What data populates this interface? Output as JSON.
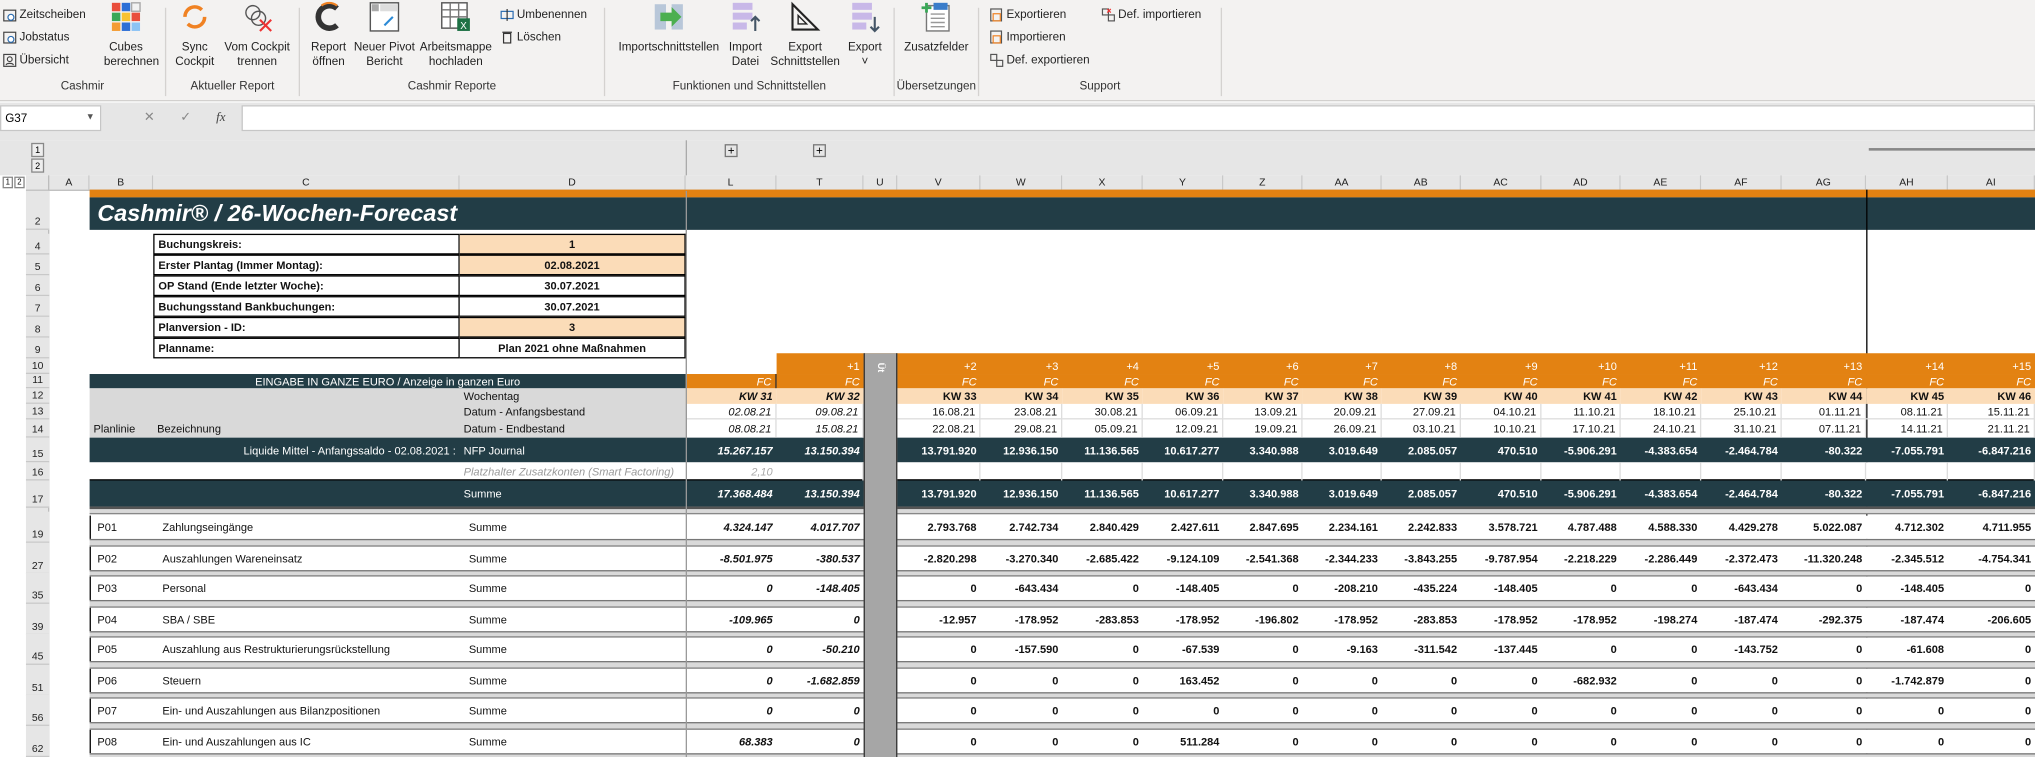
{
  "ribbon": {
    "groups": [
      {
        "label": "Cashmir",
        "items": [
          {
            "label": "Zeitscheiben",
            "icon": "calendar-clock-icon"
          },
          {
            "label": "Jobstatus",
            "icon": "calendar-clock-icon"
          },
          {
            "label": "Übersicht",
            "icon": "user-icon"
          },
          {
            "label": "Cubes\nberechnen",
            "icon": "color-cubes-icon"
          }
        ]
      },
      {
        "label": "Aktueller Report",
        "items": [
          {
            "label": "Sync\nCockpit",
            "icon": "sync-icon"
          },
          {
            "label": "Vom Cockpit\ntrennen",
            "icon": "disconnect-icon"
          }
        ]
      },
      {
        "label": "Cashmir Reporte",
        "items": [
          {
            "label": "Report\nöffnen",
            "icon": "cashmir-logo-icon"
          },
          {
            "label": "Neuer Pivot\nBericht",
            "icon": "pivot-icon"
          },
          {
            "label": "Arbeitsmappe\nhochladen",
            "icon": "excel-upload-icon"
          },
          {
            "label": "Umbenennen",
            "icon": "rename-icon"
          },
          {
            "label": "Löschen",
            "icon": "trash-icon"
          }
        ]
      },
      {
        "label": "Funktionen und Schnittstellen",
        "items": [
          {
            "label": "Importschnittstellen",
            "icon": "import-interface-icon"
          },
          {
            "label": "Import\nDatei",
            "icon": "import-file-icon"
          },
          {
            "label": "Export\nSchnittstellen",
            "icon": "export-interface-icon"
          },
          {
            "label": "Export\n˅",
            "icon": "export-icon"
          }
        ]
      },
      {
        "label": "Übersetzungen",
        "items": [
          {
            "label": "Zusatzfelder",
            "icon": "additional-fields-icon"
          }
        ]
      },
      {
        "label": "Support",
        "items": [
          {
            "label": "Exportieren",
            "icon": "export-table-icon"
          },
          {
            "label": "Importieren",
            "icon": "import-table-icon"
          },
          {
            "label": "Def. exportieren",
            "icon": "def-export-icon"
          },
          {
            "label": "Def. importieren",
            "icon": "def-import-icon"
          }
        ]
      }
    ]
  },
  "formula_bar": {
    "name_box": "G37",
    "cancel": "✕",
    "enter": "✓",
    "fx": "fx",
    "formula": ""
  },
  "outline": {
    "levels": [
      "1",
      "2"
    ],
    "expand": "+"
  },
  "columns": [
    "A",
    "B",
    "C",
    "D",
    "L",
    "T",
    "U",
    "V",
    "W",
    "X",
    "Y",
    "Z",
    "AA",
    "AB",
    "AC",
    "AD",
    "AE",
    "AF",
    "AG",
    "AH",
    "AI"
  ],
  "rows": [
    "2",
    "4",
    "5",
    "6",
    "7",
    "8",
    "9",
    "10",
    "11",
    "12",
    "13",
    "14",
    "15",
    "16",
    "17",
    "19",
    "27",
    "35",
    "39",
    "45",
    "51",
    "56",
    "62"
  ],
  "colors": {
    "dark": "#223d46",
    "orange": "#e38212",
    "peach": "#fbdcb8",
    "separator": "#d9d9d9"
  },
  "sheet": {
    "title": "Cashmir® / 26-Wochen-Forecast",
    "info": [
      {
        "label": "Buchungskreis:",
        "value": "1",
        "highlight": true
      },
      {
        "label": "Erster Plantag (Immer Montag):",
        "value": "02.08.2021",
        "highlight": true
      },
      {
        "label": "OP Stand (Ende letzter Woche):",
        "value": "30.07.2021",
        "highlight": false
      },
      {
        "label": "Buchungsstand Bankbuchungen:",
        "value": "30.07.2021",
        "highlight": false
      },
      {
        "label": "Planversion - ID:",
        "value": "3",
        "highlight": true
      },
      {
        "label": "Planname:",
        "value": "Plan 2021 ohne Maßnahmen",
        "highlight": false
      }
    ],
    "header_band": "EINGABE IN GANZE EURO / Anzeige in ganzen Euro",
    "wochentag_label": "Wochentag",
    "datum_anfang_label": "Datum - Anfangsbestand",
    "datum_end_label": "Datum - Endbestand",
    "planlinie_label": "Planlinie",
    "bezeichnung_label": "Bezeichnung",
    "hidden_col_marker": "Üt",
    "weeks": [
      {
        "col": "L",
        "offset": "",
        "type": "FC",
        "kw": "KW 31",
        "start": "02.08.21",
        "end": "08.08.21"
      },
      {
        "col": "T",
        "offset": "+1",
        "type": "FC",
        "kw": "KW 32",
        "start": "09.08.21",
        "end": "15.08.21"
      },
      {
        "col": "V",
        "offset": "+2",
        "type": "FC",
        "kw": "KW 33",
        "start": "16.08.21",
        "end": "22.08.21"
      },
      {
        "col": "W",
        "offset": "+3",
        "type": "FC",
        "kw": "KW 34",
        "start": "23.08.21",
        "end": "29.08.21"
      },
      {
        "col": "X",
        "offset": "+4",
        "type": "FC",
        "kw": "KW 35",
        "start": "30.08.21",
        "end": "05.09.21"
      },
      {
        "col": "Y",
        "offset": "+5",
        "type": "FC",
        "kw": "KW 36",
        "start": "06.09.21",
        "end": "12.09.21"
      },
      {
        "col": "Z",
        "offset": "+6",
        "type": "FC",
        "kw": "KW 37",
        "start": "13.09.21",
        "end": "19.09.21"
      },
      {
        "col": "AA",
        "offset": "+7",
        "type": "FC",
        "kw": "KW 38",
        "start": "20.09.21",
        "end": "26.09.21"
      },
      {
        "col": "AB",
        "offset": "+8",
        "type": "FC",
        "kw": "KW 39",
        "start": "27.09.21",
        "end": "03.10.21"
      },
      {
        "col": "AC",
        "offset": "+9",
        "type": "FC",
        "kw": "KW 40",
        "start": "04.10.21",
        "end": "10.10.21"
      },
      {
        "col": "AD",
        "offset": "+10",
        "type": "FC",
        "kw": "KW 41",
        "start": "11.10.21",
        "end": "17.10.21"
      },
      {
        "col": "AE",
        "offset": "+11",
        "type": "FC",
        "kw": "KW 42",
        "start": "18.10.21",
        "end": "24.10.21"
      },
      {
        "col": "AF",
        "offset": "+12",
        "type": "FC",
        "kw": "KW 43",
        "start": "25.10.21",
        "end": "31.10.21"
      },
      {
        "col": "AG",
        "offset": "+13",
        "type": "FC",
        "kw": "KW 44",
        "start": "01.11.21",
        "end": "07.11.21"
      },
      {
        "col": "AH",
        "offset": "+14",
        "type": "FC",
        "kw": "KW 45",
        "start": "08.11.21",
        "end": "14.11.21"
      },
      {
        "col": "AI",
        "offset": "+15",
        "type": "FC",
        "kw": "KW 46",
        "start": "15.11.21",
        "end": "21.11.21"
      }
    ],
    "opening": {
      "label": "Liquide Mittel - Anfangssaldo - 02.08.2021 :",
      "source": "NFP Journal",
      "values": [
        "15.267.157",
        "13.150.394",
        "13.791.920",
        "12.936.150",
        "11.136.565",
        "10.617.277",
        "3.340.988",
        "3.019.649",
        "2.085.057",
        "470.510",
        "-5.906.291",
        "-4.383.654",
        "-2.464.784",
        "-80.322",
        "-7.055.791",
        "-6.847.216"
      ]
    },
    "placeholder": {
      "label": "Platzhalter Zusatzkonten (Smart Factoring)",
      "value": "2,10"
    },
    "summe": {
      "label": "Summe",
      "values": [
        "17.368.484",
        "13.150.394",
        "13.791.920",
        "12.936.150",
        "11.136.565",
        "10.617.277",
        "3.340.988",
        "3.019.649",
        "2.085.057",
        "470.510",
        "-5.906.291",
        "-4.383.654",
        "-2.464.784",
        "-80.322",
        "-7.055.791",
        "-6.847.216"
      ]
    },
    "lines": [
      {
        "code": "P01",
        "name": "Zahlungseingänge",
        "agg": "Summe",
        "values": [
          "4.324.147",
          "4.017.707",
          "2.793.768",
          "2.742.734",
          "2.840.429",
          "2.427.611",
          "2.847.695",
          "2.234.161",
          "2.242.833",
          "3.578.721",
          "4.787.488",
          "4.588.330",
          "4.429.278",
          "5.022.087",
          "4.712.302",
          "4.711.955"
        ]
      },
      {
        "code": "P02",
        "name": "Auszahlungen Wareneinsatz",
        "agg": "Summe",
        "values": [
          "-8.501.975",
          "-380.537",
          "-2.820.298",
          "-3.270.340",
          "-2.685.422",
          "-9.124.109",
          "-2.541.368",
          "-2.344.233",
          "-3.843.255",
          "-9.787.954",
          "-2.218.229",
          "-2.286.449",
          "-2.372.473",
          "-11.320.248",
          "-2.345.512",
          "-4.754.341"
        ]
      },
      {
        "code": "P03",
        "name": "Personal",
        "agg": "Summe",
        "values": [
          "0",
          "-148.405",
          "0",
          "-643.434",
          "0",
          "-148.405",
          "0",
          "-208.210",
          "-435.224",
          "-148.405",
          "0",
          "0",
          "-643.434",
          "0",
          "-148.405",
          "0"
        ]
      },
      {
        "code": "P04",
        "name": "SBA / SBE",
        "agg": "Summe",
        "values": [
          "-109.965",
          "0",
          "-12.957",
          "-178.952",
          "-283.853",
          "-178.952",
          "-196.802",
          "-178.952",
          "-283.853",
          "-178.952",
          "-178.952",
          "-198.274",
          "-187.474",
          "-292.375",
          "-187.474",
          "-206.605"
        ]
      },
      {
        "code": "P05",
        "name": "Auszahlung aus Restrukturierungsrückstellung",
        "agg": "Summe",
        "values": [
          "0",
          "-50.210",
          "0",
          "-157.590",
          "0",
          "-67.539",
          "0",
          "-9.163",
          "-311.542",
          "-137.445",
          "0",
          "0",
          "-143.752",
          "0",
          "-61.608",
          "0"
        ]
      },
      {
        "code": "P06",
        "name": "Steuern",
        "agg": "Summe",
        "values": [
          "0",
          "-1.682.859",
          "0",
          "0",
          "0",
          "163.452",
          "0",
          "0",
          "0",
          "0",
          "-682.932",
          "0",
          "0",
          "0",
          "-1.742.879",
          "0"
        ]
      },
      {
        "code": "P07",
        "name": "Ein- und Auszahlungen aus Bilanzpositionen",
        "agg": "Summe",
        "values": [
          "0",
          "0",
          "0",
          "0",
          "0",
          "0",
          "0",
          "0",
          "0",
          "0",
          "0",
          "0",
          "0",
          "0",
          "0",
          "0"
        ]
      },
      {
        "code": "P08",
        "name": "Ein- und Auszahlungen aus IC",
        "agg": "Summe",
        "values": [
          "68.383",
          "0",
          "0",
          "0",
          "0",
          "511.284",
          "0",
          "0",
          "0",
          "0",
          "0",
          "0",
          "0",
          "0",
          "0",
          "0"
        ]
      }
    ]
  }
}
